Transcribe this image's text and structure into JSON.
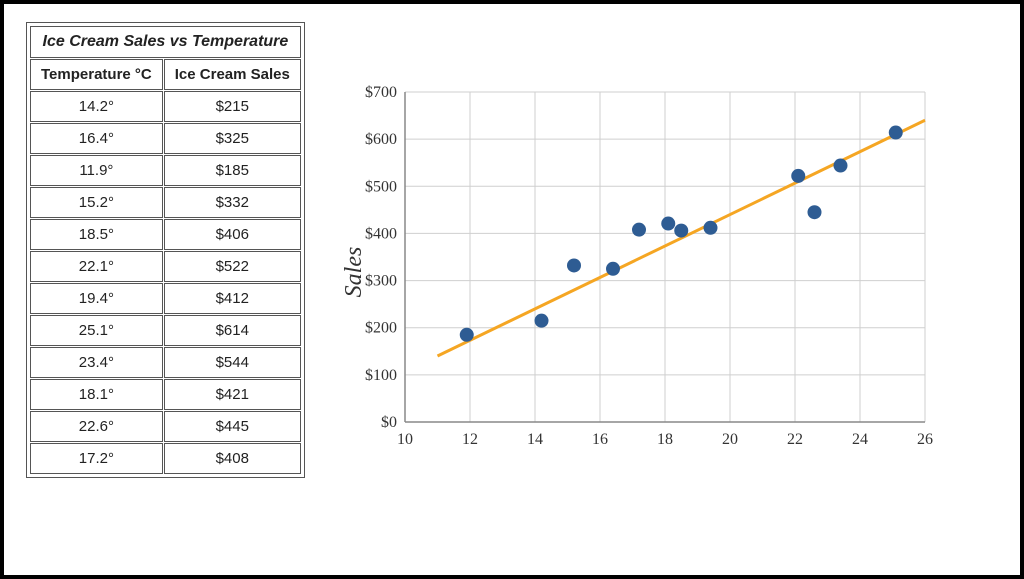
{
  "table": {
    "title": "Ice Cream Sales vs Temperature",
    "headers": [
      "Temperature °C",
      "Ice Cream Sales"
    ],
    "rows": [
      {
        "temp": "14.2°",
        "sales": "$215"
      },
      {
        "temp": "16.4°",
        "sales": "$325"
      },
      {
        "temp": "11.9°",
        "sales": "$185"
      },
      {
        "temp": "15.2°",
        "sales": "$332"
      },
      {
        "temp": "18.5°",
        "sales": "$406"
      },
      {
        "temp": "22.1°",
        "sales": "$522"
      },
      {
        "temp": "19.4°",
        "sales": "$412"
      },
      {
        "temp": "25.1°",
        "sales": "$614"
      },
      {
        "temp": "23.4°",
        "sales": "$544"
      },
      {
        "temp": "18.1°",
        "sales": "$421"
      },
      {
        "temp": "22.6°",
        "sales": "$445"
      },
      {
        "temp": "17.2°",
        "sales": "$408"
      }
    ]
  },
  "chart_data": {
    "type": "scatter",
    "title": "",
    "xlabel": "",
    "ylabel": "Sales",
    "xlim": [
      10,
      26
    ],
    "ylim": [
      0,
      700
    ],
    "xticks": [
      10,
      12,
      14,
      16,
      18,
      20,
      22,
      24,
      26
    ],
    "yticks": [
      0,
      100,
      200,
      300,
      400,
      500,
      600,
      700
    ],
    "ytick_labels": [
      "$0",
      "$100",
      "$200",
      "$300",
      "$400",
      "$500",
      "$600",
      "$700"
    ],
    "series": [
      {
        "name": "Sales",
        "x": [
          14.2,
          16.4,
          11.9,
          15.2,
          18.5,
          22.1,
          19.4,
          25.1,
          23.4,
          18.1,
          22.6,
          17.2
        ],
        "y": [
          215,
          325,
          185,
          332,
          406,
          522,
          412,
          614,
          544,
          421,
          445,
          408
        ]
      }
    ],
    "trendline": {
      "x1": 11,
      "y1": 140,
      "x2": 26,
      "y2": 640
    },
    "colors": {
      "point": "#2e5c93",
      "trend": "#f5a623",
      "grid": "#cfcfcf",
      "axis": "#888"
    }
  }
}
